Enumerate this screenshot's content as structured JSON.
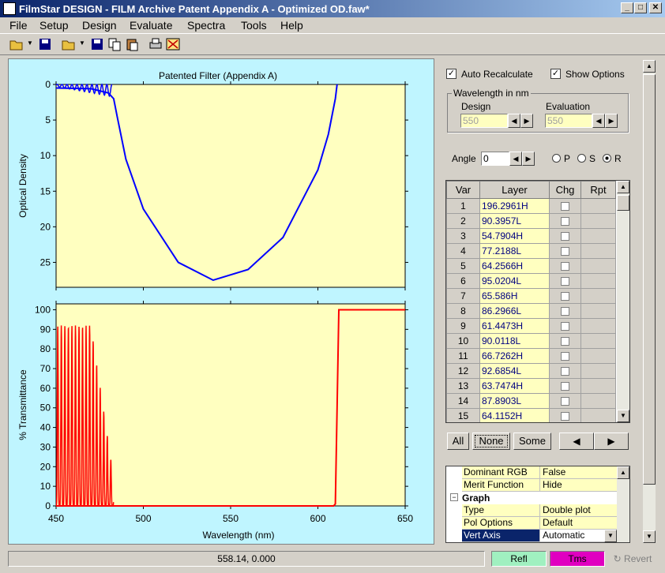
{
  "window": {
    "title": "FilmStar DESIGN - FILM Archive Patent Appendix A - Optimized OD.faw*"
  },
  "menu": [
    "File",
    "Setup",
    "Design",
    "Evaluate",
    "Spectra",
    "Tools",
    "Help"
  ],
  "graph": {
    "title": "Patented Filter (Appendix A)",
    "top_ylabel": "Optical Density",
    "bottom_ylabel": "% Transmittance",
    "xlabel": "Wavelength (nm)"
  },
  "chart_data": [
    {
      "type": "line",
      "title": "Patented Filter (Appendix A)",
      "xlabel": "",
      "ylabel": "Optical Density",
      "xlim": [
        450,
        650
      ],
      "ylim": [
        0,
        28.5
      ],
      "y_inverted": true,
      "yticks": [
        "0",
        "5",
        "10",
        "15",
        "20",
        "25"
      ],
      "color": "#0000ff",
      "series": [
        {
          "x": [
            450,
            470,
            480,
            483,
            485,
            490,
            500,
            520,
            540,
            560,
            580,
            600,
            606,
            610,
            611
          ],
          "values": [
            0.5,
            0.6,
            1.2,
            2.0,
            4.5,
            10.5,
            17.5,
            25.0,
            27.5,
            26.0,
            21.5,
            12.0,
            7.0,
            2.0,
            0
          ]
        }
      ]
    },
    {
      "type": "line",
      "title": "",
      "xlabel": "Wavelength (nm)",
      "ylabel": "% Transmittance",
      "xlim": [
        450,
        650
      ],
      "ylim": [
        0,
        103
      ],
      "xticks": [
        "450",
        "500",
        "550",
        "600",
        "650"
      ],
      "yticks": [
        "0",
        "10",
        "20",
        "30",
        "40",
        "50",
        "60",
        "70",
        "80",
        "90",
        "100"
      ],
      "color": "#ff0000",
      "series": [
        {
          "x": [
            450,
            482,
            483,
            609,
            610,
            611,
            612,
            650
          ],
          "values": [
            0,
            0,
            0,
            0,
            1,
            50,
            100,
            100
          ]
        }
      ]
    }
  ],
  "options": {
    "auto_recalculate": "Auto Recalculate",
    "show_options": "Show Options",
    "wavelength_group": "Wavelength in nm",
    "design_label": "Design",
    "design_value": "550",
    "evaluation_label": "Evaluation",
    "evaluation_value": "550",
    "angle_label": "Angle",
    "angle_value": "0",
    "pol_p": "P",
    "pol_s": "S",
    "pol_r": "R"
  },
  "layer_table": {
    "headers": [
      "Var",
      "Layer",
      "Chg",
      "Rpt"
    ],
    "rows": [
      [
        "1",
        "196.2961H"
      ],
      [
        "2",
        "90.3957L"
      ],
      [
        "3",
        "54.7904H"
      ],
      [
        "4",
        "77.2188L"
      ],
      [
        "5",
        "64.2566H"
      ],
      [
        "6",
        "95.0204L"
      ],
      [
        "7",
        "65.586H"
      ],
      [
        "8",
        "86.2966L"
      ],
      [
        "9",
        "61.4473H"
      ],
      [
        "10",
        "90.0118L"
      ],
      [
        "11",
        "66.7262H"
      ],
      [
        "12",
        "92.6854L"
      ],
      [
        "13",
        "63.7474H"
      ],
      [
        "14",
        "87.8903L"
      ],
      [
        "15",
        "64.1152H"
      ]
    ]
  },
  "buttons": {
    "all": "All",
    "none": "None",
    "some": "Some"
  },
  "properties": [
    {
      "k": "Dominant RGB",
      "v": "False"
    },
    {
      "k": "Merit Function",
      "v": "Hide"
    },
    {
      "k": "Graph",
      "v": "",
      "group": true
    },
    {
      "k": "Type",
      "v": "Double plot"
    },
    {
      "k": "Pol Options",
      "v": "Default"
    },
    {
      "k": "Vert Axis",
      "v": "Automatic",
      "selected": true
    }
  ],
  "status": {
    "coords": "558.14, 0.000",
    "refl": "Refl",
    "tms": "Tms",
    "revert": "Revert",
    "refl_color": "#a0f0c0",
    "tms_color": "#e000c0"
  }
}
